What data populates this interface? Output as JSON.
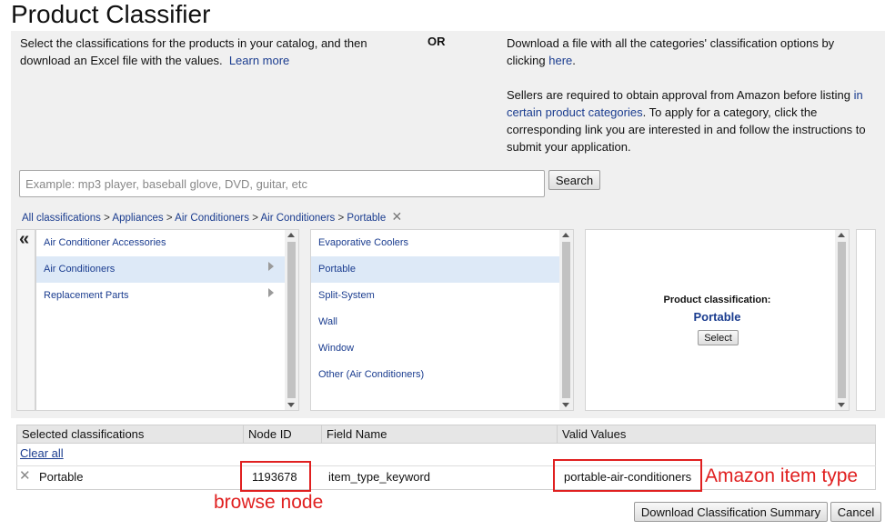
{
  "page": {
    "title": "Product Classifier"
  },
  "intro": {
    "left_text": "Select the classifications for the products in your catalog, and then download an Excel file with the values.",
    "learn_more": "Learn more",
    "or_label": "OR",
    "right_text_prefix": "Download a file with all the categories' classification options by clicking",
    "here_link": "here",
    "right_text_suffix": ".",
    "approval_prefix": "Sellers are required to obtain approval from Amazon before listing",
    "approval_link": "in certain product categories",
    "approval_suffix": ". To apply for a category, click the corresponding link you are interested in and follow the instructions to submit your application."
  },
  "search": {
    "value": "",
    "placeholder": "Example: mp3 player, baseball glove, DVD, guitar, etc",
    "button_label": "Search"
  },
  "breadcrumb": {
    "items": [
      "All classifications",
      "Appliances",
      "Air Conditioners",
      "Air Conditioners",
      "Portable"
    ],
    "separator": ">",
    "remove_glyph": "✕"
  },
  "browser": {
    "collapse_glyph": "«",
    "column1": [
      {
        "label": "Air Conditioner Accessories",
        "has_children": false,
        "selected": false
      },
      {
        "label": "Air Conditioners",
        "has_children": true,
        "selected": true
      },
      {
        "label": "Replacement Parts",
        "has_children": true,
        "selected": false
      }
    ],
    "column2": [
      {
        "label": "Evaporative Coolers",
        "selected": false
      },
      {
        "label": "Portable",
        "selected": true
      },
      {
        "label": "Split-System",
        "selected": false
      },
      {
        "label": "Wall",
        "selected": false
      },
      {
        "label": "Window",
        "selected": false
      },
      {
        "label": "Other (Air Conditioners)",
        "selected": false
      }
    ],
    "detail": {
      "label": "Product classification:",
      "value": "Portable",
      "select_label": "Select"
    }
  },
  "table": {
    "headers": [
      "Selected classifications",
      "Node ID",
      "Field Name",
      "Valid Values"
    ],
    "clear_all": "Clear all",
    "rows": [
      {
        "remove_glyph": "✕",
        "classification": "Portable",
        "node_id": "1193678",
        "field_name": "item_type_keyword",
        "valid_values": "portable-air-conditioners"
      }
    ]
  },
  "annotations": {
    "amazon_item_type": "Amazon item type",
    "browse_node": "browse node",
    "color": "#e02020"
  },
  "footer": {
    "download_label": "Download Classification Summary",
    "cancel_label": "Cancel"
  },
  "colors": {
    "link": "#1a3c8f",
    "panel_bg": "#f0f0f0",
    "selected_bg": "#dde9f7"
  }
}
